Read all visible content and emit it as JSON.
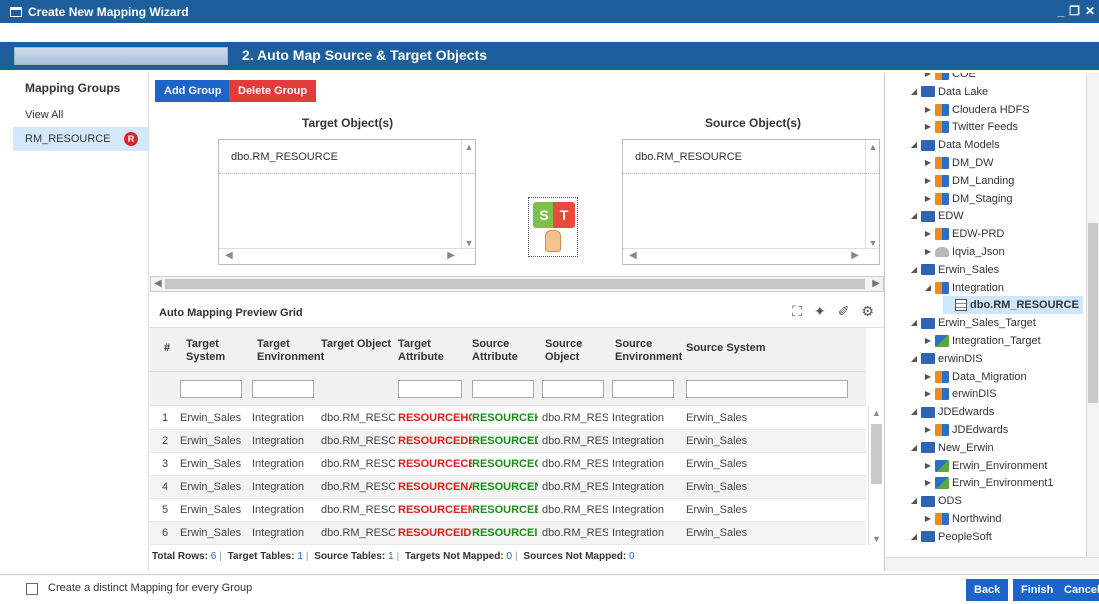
{
  "window": {
    "title": "Create New Mapping Wizard",
    "controls": [
      "_",
      "❐",
      "✕"
    ]
  },
  "step": {
    "title": "2. Auto Map Source & Target Objects"
  },
  "left": {
    "header": "Mapping Groups",
    "items": [
      {
        "label": "View All"
      },
      {
        "label": "RM_RESOURCE",
        "badge": "R"
      }
    ]
  },
  "toolbar": {
    "add_group": "Add Group",
    "delete_group": "Delete Group"
  },
  "target": {
    "label": "Target Object(s)",
    "value": "dbo.RM_RESOURCE"
  },
  "source": {
    "label": "Source Object(s)",
    "value": "dbo.RM_RESOURCE"
  },
  "automap": {
    "s": "S",
    "t": "T"
  },
  "grid": {
    "title": "Auto Mapping Preview Grid",
    "columns": [
      "#",
      "Target System",
      "Target Environment",
      "Target Object",
      "Target Attribute",
      "Source Attribute",
      "Source Object",
      "Source Environment",
      "Source System"
    ],
    "rows": [
      [
        "1",
        "Erwin_Sales",
        "Integration",
        "dbo.RM_RESOU",
        "RESOURCEHOM",
        "RESOURCEHOM",
        "dbo.RM_RESOU",
        "Integration",
        "Erwin_Sales"
      ],
      [
        "2",
        "Erwin_Sales",
        "Integration",
        "dbo.RM_RESOU",
        "RESOURCEDESC",
        "RESOURCEDESC",
        "dbo.RM_RESOU",
        "Integration",
        "Erwin_Sales"
      ],
      [
        "3",
        "Erwin_Sales",
        "Integration",
        "dbo.RM_RESOU",
        "RESOURCECELL",
        "RESOURCECELL",
        "dbo.RM_RESOU",
        "Integration",
        "Erwin_Sales"
      ],
      [
        "4",
        "Erwin_Sales",
        "Integration",
        "dbo.RM_RESOU",
        "RESOURCENAM",
        "RESOURCENAM",
        "dbo.RM_RESOU",
        "Integration",
        "Erwin_Sales"
      ],
      [
        "5",
        "Erwin_Sales",
        "Integration",
        "dbo.RM_RESOU",
        "RESOURCEEMA",
        "RESOURCEEMA",
        "dbo.RM_RESOU",
        "Integration",
        "Erwin_Sales"
      ],
      [
        "6",
        "Erwin_Sales",
        "Integration",
        "dbo.RM_RESOU",
        "RESOURCEID",
        "RESOURCEID",
        "dbo.RM_RESOU",
        "Integration",
        "Erwin_Sales"
      ]
    ]
  },
  "status": {
    "total_rows_label": "Total Rows:",
    "total_rows": "6",
    "target_tables_label": "Target Tables:",
    "target_tables": "1",
    "source_tables_label": "Source Tables:",
    "source_tables": "1",
    "targets_not_mapped_label": "Targets Not Mapped:",
    "targets_not_mapped": "0",
    "sources_not_mapped_label": "Sources Not Mapped:",
    "sources_not_mapped": "0"
  },
  "tree": [
    {
      "label": "COE",
      "kind": "cat",
      "level": 2,
      "arrow": "▶"
    },
    {
      "label": "Data Lake",
      "kind": "fold",
      "level": 1,
      "arrow": "◢"
    },
    {
      "label": "Cloudera HDFS",
      "kind": "cat",
      "level": 2,
      "arrow": "▶"
    },
    {
      "label": "Twitter Feeds",
      "kind": "cat",
      "level": 2,
      "arrow": "▶"
    },
    {
      "label": "Data Models",
      "kind": "fold",
      "level": 1,
      "arrow": "◢"
    },
    {
      "label": "DM_DW",
      "kind": "cat",
      "level": 2,
      "arrow": "▶"
    },
    {
      "label": "DM_Landing",
      "kind": "cat",
      "level": 2,
      "arrow": "▶"
    },
    {
      "label": "DM_Staging",
      "kind": "cat",
      "level": 2,
      "arrow": "▶"
    },
    {
      "label": "EDW",
      "kind": "fold",
      "level": 1,
      "arrow": "◢"
    },
    {
      "label": "EDW-PRD",
      "kind": "cat",
      "level": 2,
      "arrow": "▶"
    },
    {
      "label": "Iqvia_Json",
      "kind": "disk",
      "level": 2,
      "arrow": "▶"
    },
    {
      "label": "Erwin_Sales",
      "kind": "fold",
      "level": 1,
      "arrow": "◢"
    },
    {
      "label": "Integration",
      "kind": "cat",
      "level": 2,
      "arrow": "◢"
    },
    {
      "label": "dbo.RM_RESOURCE",
      "kind": "tbl",
      "level": 3,
      "arrow": "",
      "selected": true
    },
    {
      "label": "Erwin_Sales_Target",
      "kind": "fold",
      "level": 1,
      "arrow": "◢"
    },
    {
      "label": "Integration_Target",
      "kind": "env",
      "level": 2,
      "arrow": "▶"
    },
    {
      "label": "erwinDIS",
      "kind": "fold",
      "level": 1,
      "arrow": "◢"
    },
    {
      "label": "Data_Migration",
      "kind": "cat",
      "level": 2,
      "arrow": "▶"
    },
    {
      "label": "erwinDIS",
      "kind": "cat",
      "level": 2,
      "arrow": "▶"
    },
    {
      "label": "JDEdwards",
      "kind": "fold",
      "level": 1,
      "arrow": "◢"
    },
    {
      "label": "JDEdwards",
      "kind": "cat",
      "level": 2,
      "arrow": "▶"
    },
    {
      "label": "New_Erwin",
      "kind": "fold",
      "level": 1,
      "arrow": "◢"
    },
    {
      "label": "Erwin_Environment",
      "kind": "env",
      "level": 2,
      "arrow": "▶"
    },
    {
      "label": "Erwin_Environment1",
      "kind": "env",
      "level": 2,
      "arrow": "▶"
    },
    {
      "label": "ODS",
      "kind": "fold",
      "level": 1,
      "arrow": "◢"
    },
    {
      "label": "Northwind",
      "kind": "cat",
      "level": 2,
      "arrow": "▶"
    },
    {
      "label": "PeopleSoft",
      "kind": "fold",
      "level": 1,
      "arrow": "◢"
    }
  ],
  "footer": {
    "checkbox_label": "Create a distinct Mapping for every Group",
    "back": "Back",
    "finish": "Finish",
    "cancel": "Cancel"
  }
}
